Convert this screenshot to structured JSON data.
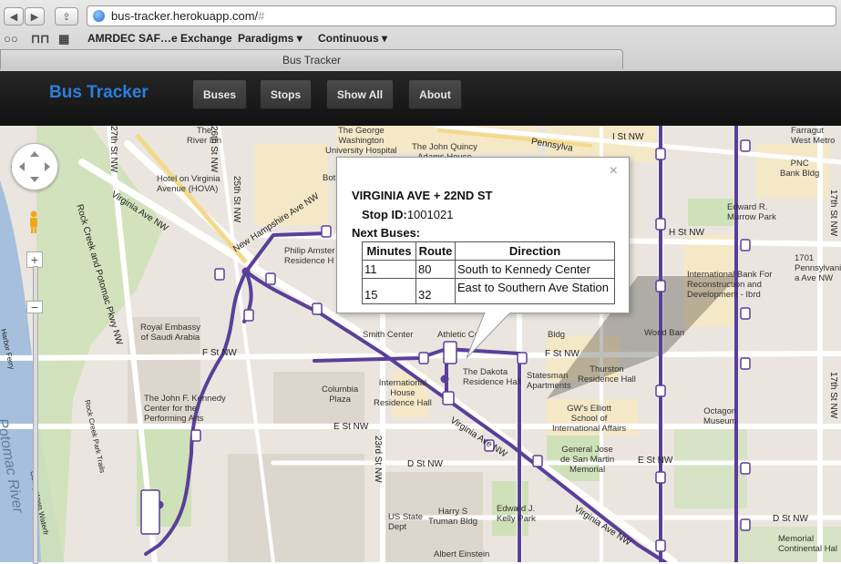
{
  "browser": {
    "url": "bus-tracker.herokuapp.com/",
    "url_hash": "#",
    "bookmarks": [
      "AMRDEC SAF…e Exchange",
      "Paradigms",
      "Continuous"
    ],
    "tab_title": "Bus Tracker"
  },
  "app": {
    "brand": "Bus Tracker",
    "nav": [
      "Buses",
      "Stops",
      "Show All",
      "About"
    ]
  },
  "popup": {
    "close": "×",
    "title": "VIRGINIA AVE + 22ND ST",
    "stop_label": "Stop ID:",
    "stop_id": "1001021",
    "next_label": "Next Buses:",
    "columns": [
      "Minutes",
      "Route",
      "Direction"
    ],
    "rows": [
      {
        "minutes": "11",
        "route": "80",
        "direction": "South to Kennedy Center"
      },
      {
        "minutes": "15",
        "route": "32",
        "direction": "East to Southern Ave Station"
      }
    ]
  },
  "map": {
    "route_color": "#5a3f9a",
    "labels": {
      "river_inn": "The\nRiver Inn",
      "gwu": "The George\nWashington\nUniversity Hospital",
      "quincy": "The John Quincy\nAdams House",
      "hojo": "Hotel on Virginia\nAvenue (HOVA)",
      "amster": "Philip Amster\nResidence H",
      "saudi": "Royal Embassy\nof Saudi Arabia",
      "columbia": "Columbia\nPlaza",
      "intl_house": "International\nHouse\nResidence Hall",
      "kennedy": "The John F. Kennedy\nCenter for the\nPerforming Arts",
      "dakota": "The Dakota\nResidence Hall",
      "statesman": "Statesman\nApartments",
      "thurston": "Thurston\nResidence Hall",
      "elliott": "GW's Elliott\nSchool of\nInternational Affairs",
      "san_martin": "General Jose\nde San Martin\nMemorial",
      "kelly": "Edward J.\nKelly Park",
      "usstate": "US State\nDept",
      "truman": "Harry S\nTruman Bldg",
      "einstein": "Albert Einstein",
      "intl_bank": "International Bank For\nReconstruction and\nDevelopment - Ibrd",
      "pnc": "PNC\nBank Bldg",
      "murrow": "Edward R.\nMurrow Park",
      "farragut": "Farragut\nWest Metro",
      "octagon": "Octagon\nMuseum",
      "continental": "Memorial\nContinental Hal",
      "penn1701": "1701\nPennsylvani\na Ave NW",
      "world_bank": "World Ban",
      "bldg": "Bldg",
      "athletic": "Athletic Cen",
      "smith": "Smith Center",
      "bot": "Bot",
      "river_big": "Potomac River",
      "st_virginia": "Virginia Ave NW",
      "st_nh": "New Hampshire Ave NW",
      "st_rock": "Rock Creek and Potomac Pkwy NW",
      "st_rock_trails": "Rock Creek Park Trails",
      "st_27": "27th St NW",
      "st_26": "26th St NW",
      "st_25": "25th St NW",
      "st_23": "23rd St NW",
      "st_17a": "17th St NW",
      "st_17b": "17th St NW",
      "st_fnw1": "F St NW",
      "st_fnw2": "F St NW",
      "st_enw1": "E St NW",
      "st_enw2": "E St NW",
      "st_dnw1": "D St NW",
      "st_dnw2": "D St NW",
      "st_hnw": "H St NW",
      "st_inw": "I St NW",
      "st_penn": "Pennsylva",
      "st_gtown": "Georgetown Waterfr",
      "st_harbor": "Harbor Ferry",
      "st_virginia2": "Virginia Ave NW",
      "st_virginia3": "Virginia Ave NW"
    }
  }
}
